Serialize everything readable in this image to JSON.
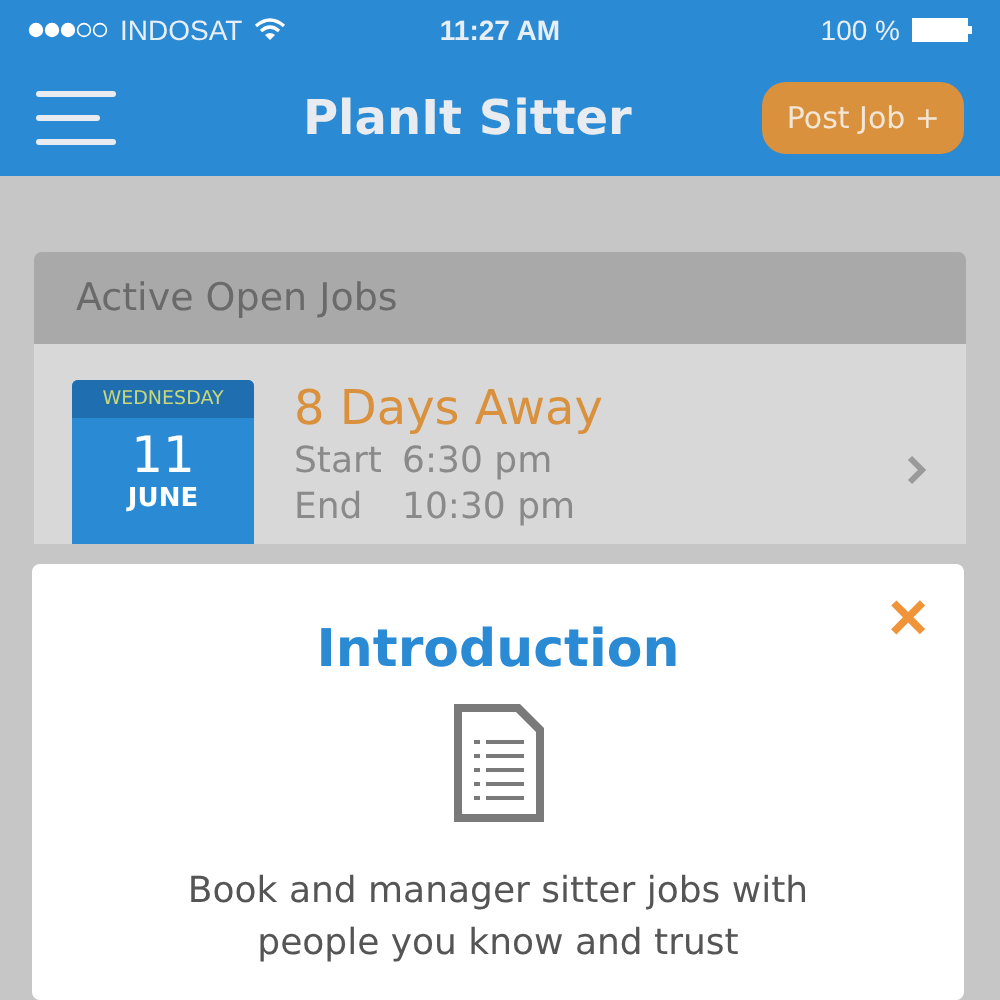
{
  "status_bar": {
    "carrier": "INDOSAT",
    "time": "11:27 AM",
    "battery": "100 %"
  },
  "nav": {
    "title": "PlanIt Sitter",
    "action": "Post Job +"
  },
  "jobs_card": {
    "title": "Active Open Jobs",
    "jobs": [
      {
        "weekday": "WEDNESDAY",
        "day": "11",
        "month": "JUNE",
        "countdown": "8 Days Away",
        "start_label": "Start",
        "start": "6:30 pm",
        "end_label": "End",
        "end": "10:30 pm"
      }
    ]
  },
  "modal": {
    "title": "Introduction",
    "close": "×",
    "text": "Book and manager sitter jobs with people you know and trust"
  }
}
